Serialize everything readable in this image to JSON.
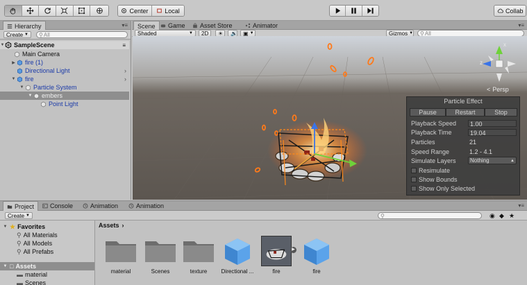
{
  "toolbar": {
    "pivot_label": "Center",
    "space_label": "Local",
    "collab_label": "Collab"
  },
  "hierarchy": {
    "tab": "Hierarchy",
    "create": "Create",
    "search_placeholder": "All",
    "scene_name": "SampleScene",
    "items": [
      {
        "label": "Main Camera"
      },
      {
        "label": "fire (1)"
      },
      {
        "label": "Directional Light"
      },
      {
        "label": "fire"
      },
      {
        "label": "Particle System"
      },
      {
        "label": "embers"
      },
      {
        "label": "Point Light"
      }
    ]
  },
  "scene": {
    "tabs": [
      "Scene",
      "Game",
      "Asset Store",
      "Animator"
    ],
    "shading": "Shaded",
    "mode_2d": "2D",
    "gizmos": "Gizmos",
    "search_placeholder": "All",
    "persp_label": "Persp",
    "axis_x": "x",
    "axis_z": "z"
  },
  "particle_effect": {
    "title": "Particle Effect",
    "buttons": [
      "Pause",
      "Restart",
      "Stop"
    ],
    "playback_speed_label": "Playback Speed",
    "playback_speed": "1.00",
    "playback_time_label": "Playback Time",
    "playback_time": "19.04",
    "particles_label": "Particles",
    "particles": "21",
    "speed_range_label": "Speed Range",
    "speed_range": "1.2 - 4.1",
    "simulate_layers_label": "Simulate Layers",
    "simulate_layers": "Nothing",
    "resimulate": "Resimulate",
    "show_bounds": "Show Bounds",
    "show_only_selected": "Show Only Selected"
  },
  "project": {
    "tabs": [
      "Project",
      "Console",
      "Animation",
      "Animation"
    ],
    "create": "Create",
    "favorites_label": "Favorites",
    "favorites": [
      "All Materials",
      "All Models",
      "All Prefabs"
    ],
    "assets_label": "Assets",
    "asset_folders": [
      "material",
      "Scenes"
    ],
    "breadcrumb": "Assets",
    "assets": [
      {
        "label": "material"
      },
      {
        "label": "Scenes"
      },
      {
        "label": "texture"
      },
      {
        "label": "Directional ..."
      },
      {
        "label": "fire"
      },
      {
        "label": "fire"
      }
    ]
  }
}
